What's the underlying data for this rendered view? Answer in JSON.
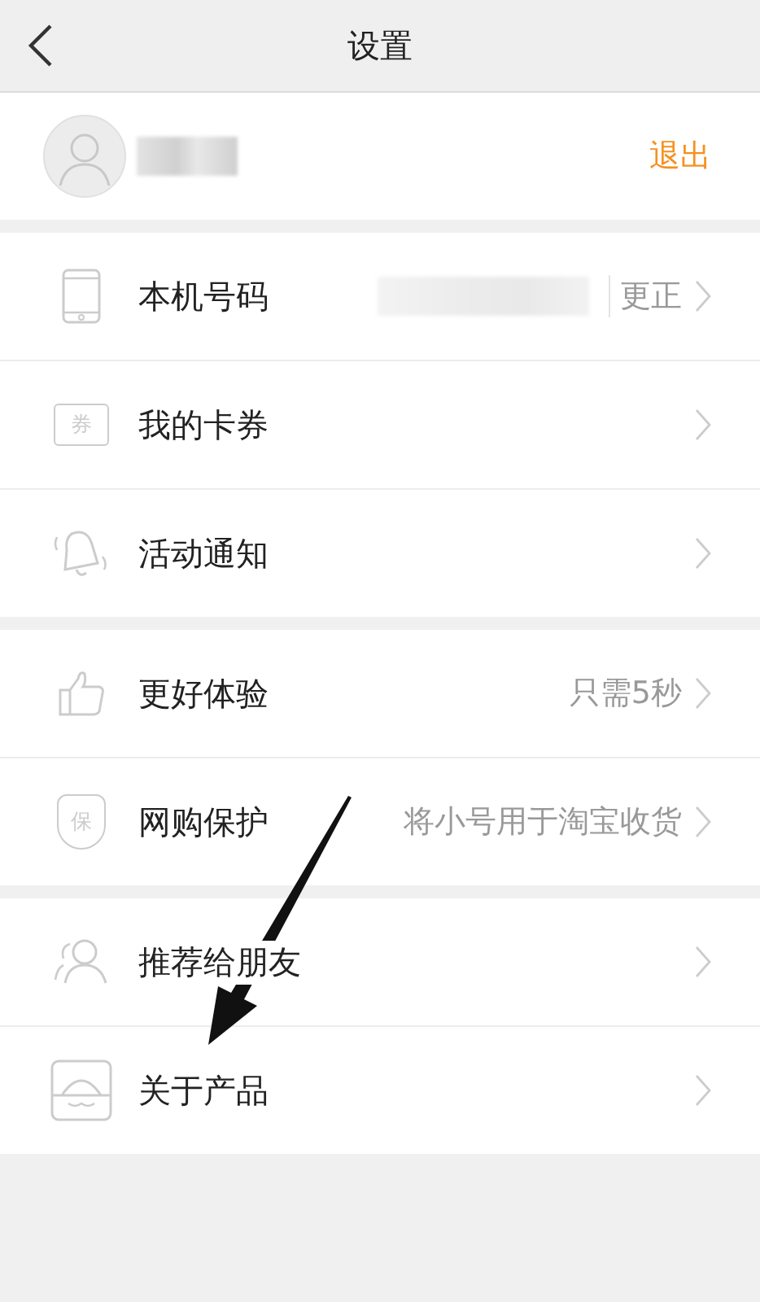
{
  "header": {
    "title": "设置"
  },
  "profile": {
    "logout": "退出",
    "name_redacted": true
  },
  "groups": [
    [
      {
        "kind": "phone",
        "label": "本机号码",
        "redacted": true,
        "action": "更正"
      },
      {
        "kind": "ticket",
        "icon_text": "券",
        "label": "我的卡券"
      },
      {
        "kind": "bell",
        "label": "活动通知"
      }
    ],
    [
      {
        "kind": "thumb",
        "label": "更好体验",
        "value": "只需5秒"
      },
      {
        "kind": "shield",
        "icon_text": "保",
        "label": "网购保护",
        "value": "将小号用于淘宝收货"
      }
    ],
    [
      {
        "kind": "people",
        "label": "推荐给朋友"
      },
      {
        "kind": "box",
        "label": "关于产品"
      }
    ]
  ]
}
